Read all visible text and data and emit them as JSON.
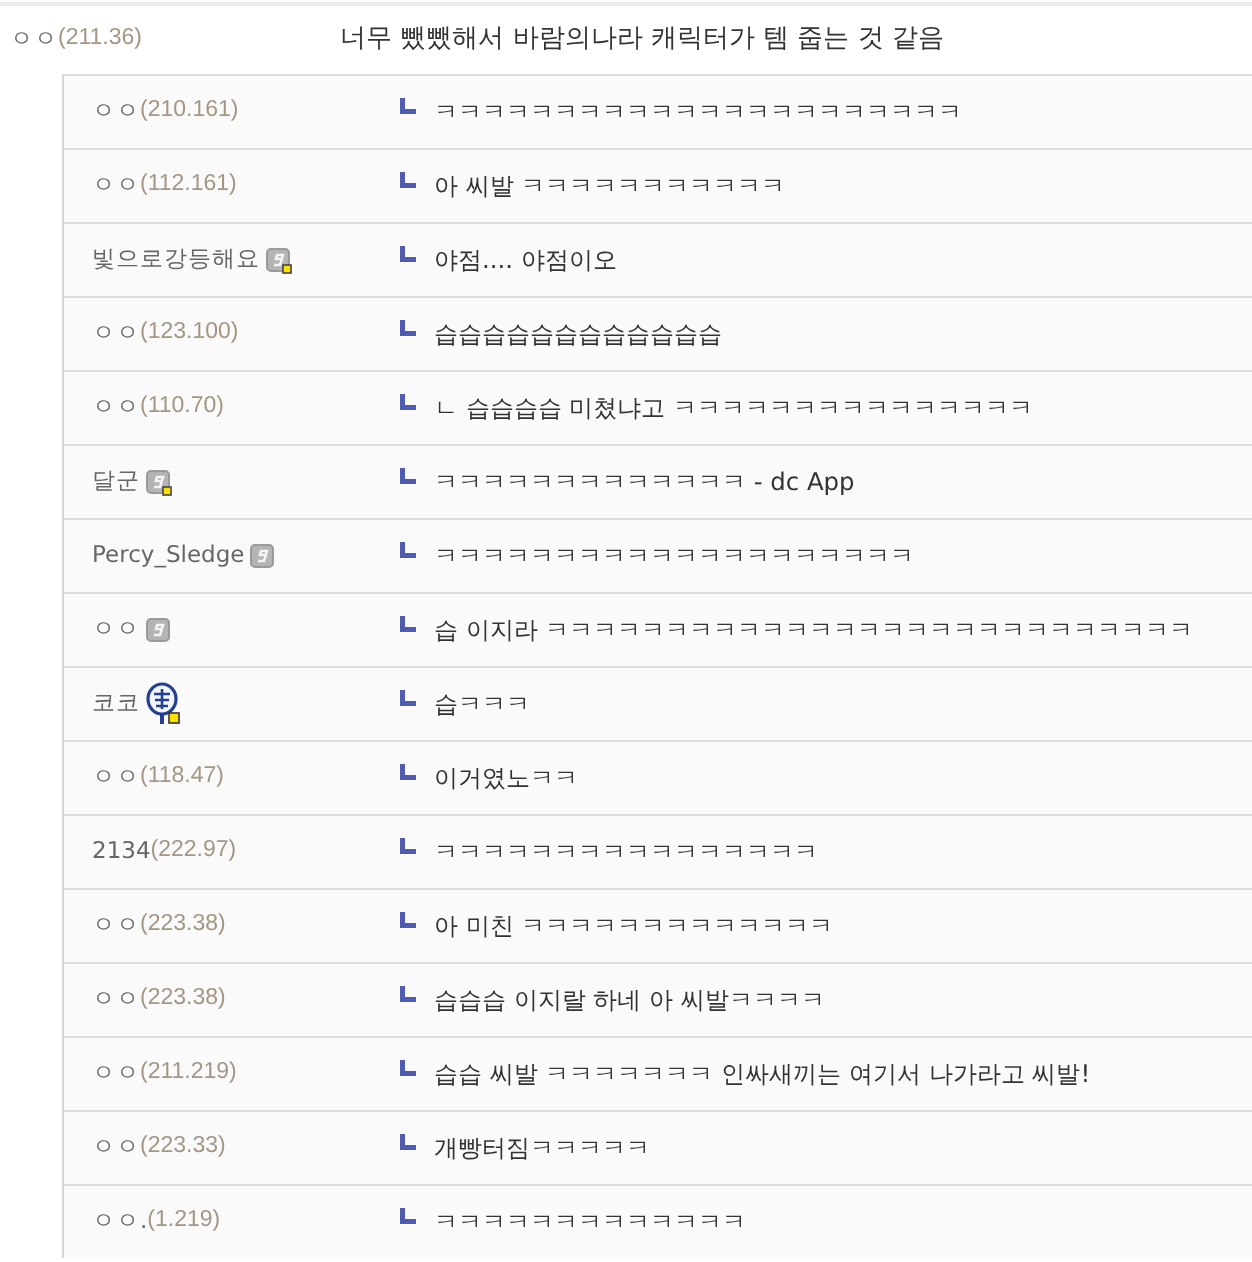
{
  "comment": {
    "kind": "guest",
    "nick": "ㅇㅇ",
    "ip": "(211.36)",
    "text": "너무 뺐뺐해서 바람의나라 캐릭터가 템 줍는 것 같음",
    "replies": [
      {
        "kind": "guest",
        "nick": "ㅇㅇ",
        "ip": "(210.161)",
        "text": "ㅋㅋㅋㅋㅋㅋㅋㅋㅋㅋㅋㅋㅋㅋㅋㅋㅋㅋㅋㅋㅋㅋ"
      },
      {
        "kind": "guest",
        "nick": "ㅇㅇ",
        "ip": "(112.161)",
        "text": "아 씨발 ㅋㅋㅋㅋㅋㅋㅋㅋㅋㅋㅋ"
      },
      {
        "kind": "member-flagged",
        "nick": "빛으로강등해요",
        "text": "야점.... 야점이오"
      },
      {
        "kind": "guest",
        "nick": "ㅇㅇ",
        "ip": "(123.100)",
        "text": "습습습습습습습습습습습습"
      },
      {
        "kind": "guest",
        "nick": "ㅇㅇ",
        "ip": "(110.70)",
        "text": "ㄴ 습습습습 미쳤냐고 ㅋㅋㅋㅋㅋㅋㅋㅋㅋㅋㅋㅋㅋㅋㅋ"
      },
      {
        "kind": "member-flagged",
        "nick": "달군",
        "text": "ㅋㅋㅋㅋㅋㅋㅋㅋㅋㅋㅋㅋㅋ - dc App"
      },
      {
        "kind": "member",
        "nick": "Percy_Sledge",
        "text": "ㅋㅋㅋㅋㅋㅋㅋㅋㅋㅋㅋㅋㅋㅋㅋㅋㅋㅋㅋㅋ"
      },
      {
        "kind": "member",
        "nick": "ㅇㅇ",
        "text": "습 이지라 ㅋㅋㅋㅋㅋㅋㅋㅋㅋㅋㅋㅋㅋㅋㅋㅋㅋㅋㅋㅋㅋㅋㅋㅋㅋㅋㅋ"
      },
      {
        "kind": "emblem",
        "nick": "코코",
        "text": "습ㅋㅋㅋ"
      },
      {
        "kind": "guest",
        "nick": "ㅇㅇ",
        "ip": "(118.47)",
        "text": "이거였노ㅋㅋ"
      },
      {
        "kind": "guest",
        "nick": "2134",
        "ip": "(222.97)",
        "text": "ㅋㅋㅋㅋㅋㅋㅋㅋㅋㅋㅋㅋㅋㅋㅋㅋ"
      },
      {
        "kind": "guest",
        "nick": "ㅇㅇ",
        "ip": "(223.38)",
        "text": "아 미친 ㅋㅋㅋㅋㅋㅋㅋㅋㅋㅋㅋㅋㅋ"
      },
      {
        "kind": "guest",
        "nick": "ㅇㅇ",
        "ip": "(223.38)",
        "text": "습습습 이지랄 하네 아 씨발ㅋㅋㅋㅋ"
      },
      {
        "kind": "guest",
        "nick": "ㅇㅇ",
        "ip": "(211.219)",
        "text": "습습 씨발 ㅋㅋㅋㅋㅋㅋㅋ 인싸새끼는 여기서 나가라고 씨발!"
      },
      {
        "kind": "guest",
        "nick": "ㅇㅇ",
        "ip": "(223.33)",
        "text": "개빵터짐ㅋㅋㅋㅋㅋ"
      },
      {
        "kind": "guest",
        "nick": "ㅇㅇ.",
        "ip": "(1.219)",
        "text": "ㅋㅋㅋㅋㅋㅋㅋㅋㅋㅋㅋㅋㅋ"
      }
    ]
  }
}
